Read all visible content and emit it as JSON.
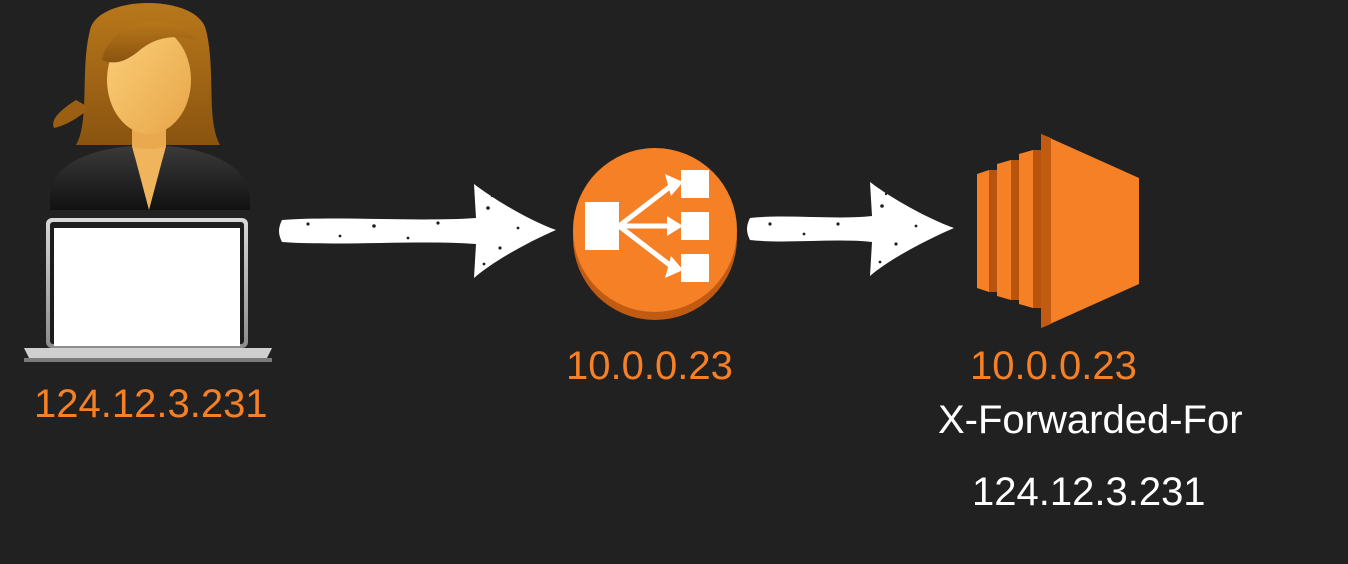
{
  "colors": {
    "background": "#212121",
    "accent": "#f58025",
    "text_light": "#ffffff"
  },
  "client": {
    "icon": "user-with-laptop-icon",
    "ip": "124.12.3.231"
  },
  "load_balancer": {
    "icon": "load-balancer-icon",
    "ip": "10.0.0.23"
  },
  "server": {
    "icon": "ec2-instance-icon",
    "ip": "10.0.0.23",
    "header_name": "X-Forwarded-For",
    "header_value": "124.12.3.231"
  },
  "arrows": [
    "client-to-load-balancer",
    "load-balancer-to-server"
  ]
}
